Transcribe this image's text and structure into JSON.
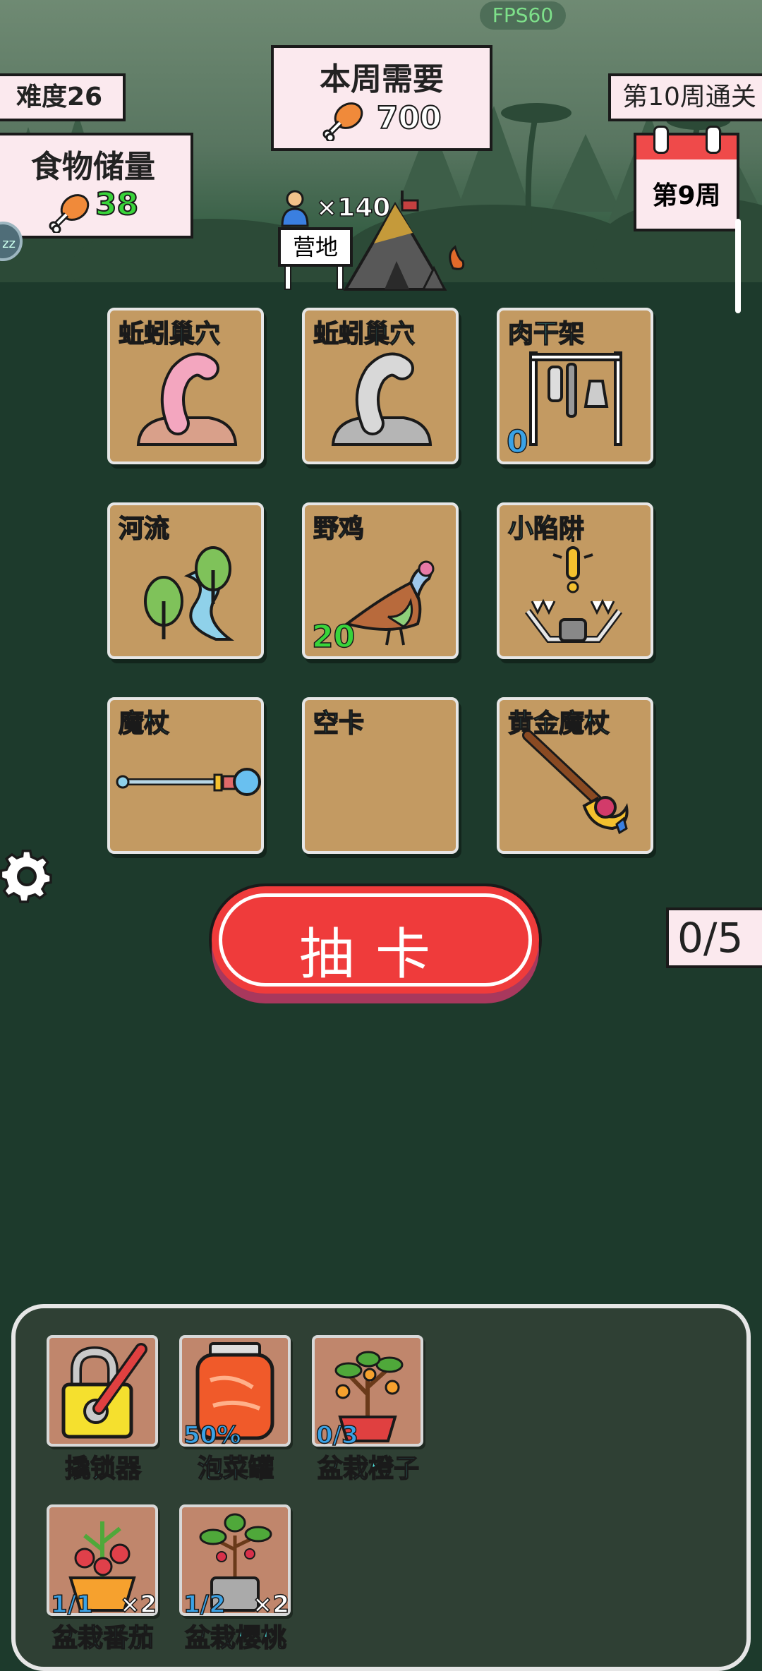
{
  "hud": {
    "fps": "FPS60",
    "difficulty": "难度26",
    "weekly_need_title": "本周需要",
    "weekly_need_value": "700",
    "food_storage_title": "食物储量",
    "food_storage_value": "38",
    "clear_goal": "第10周通关",
    "current_week": "第9周",
    "population": "×140",
    "camp_label": "营地"
  },
  "cards": [
    {
      "name": "蚯蚓巢穴",
      "icon": "worm-nest-pink-icon",
      "count": ""
    },
    {
      "name": "蚯蚓巢穴",
      "icon": "worm-nest-gray-icon",
      "count": ""
    },
    {
      "name": "肉干架",
      "icon": "meat-rack-icon",
      "count": "0"
    },
    {
      "name": "河流",
      "icon": "river-icon",
      "count": ""
    },
    {
      "name": "野鸡",
      "icon": "pheasant-icon",
      "count": "20"
    },
    {
      "name": "小陷阱",
      "icon": "bear-trap-icon",
      "count": ""
    },
    {
      "name": "魔杖",
      "icon": "magic-wand-icon",
      "count": ""
    },
    {
      "name": "空卡",
      "icon": "",
      "count": ""
    },
    {
      "name": "黄金魔杖",
      "icon": "golden-wand-icon",
      "count": ""
    }
  ],
  "draw": {
    "label": "抽卡",
    "count": "0/5"
  },
  "inventory": [
    {
      "name": "撬锁器",
      "icon": "lock-pick-icon",
      "progress": "",
      "multiplier": ""
    },
    {
      "name": "泡菜罐",
      "icon": "pickle-jar-icon",
      "progress": "50%",
      "multiplier": ""
    },
    {
      "name": "盆栽橙子",
      "icon": "potted-orange-icon",
      "progress": "0/3",
      "multiplier": ""
    },
    {
      "name": "盆栽番茄",
      "icon": "potted-tomato-icon",
      "progress": "1/1",
      "multiplier": "×2"
    },
    {
      "name": "盆栽樱桃",
      "icon": "potted-cherry-icon",
      "progress": "1/2",
      "multiplier": "×2"
    }
  ],
  "colors": {
    "card_name": "#4fe3e0",
    "count_blue": "#3aa2e6",
    "count_green": "#39d43a",
    "draw_button": "#ef3b3b"
  }
}
